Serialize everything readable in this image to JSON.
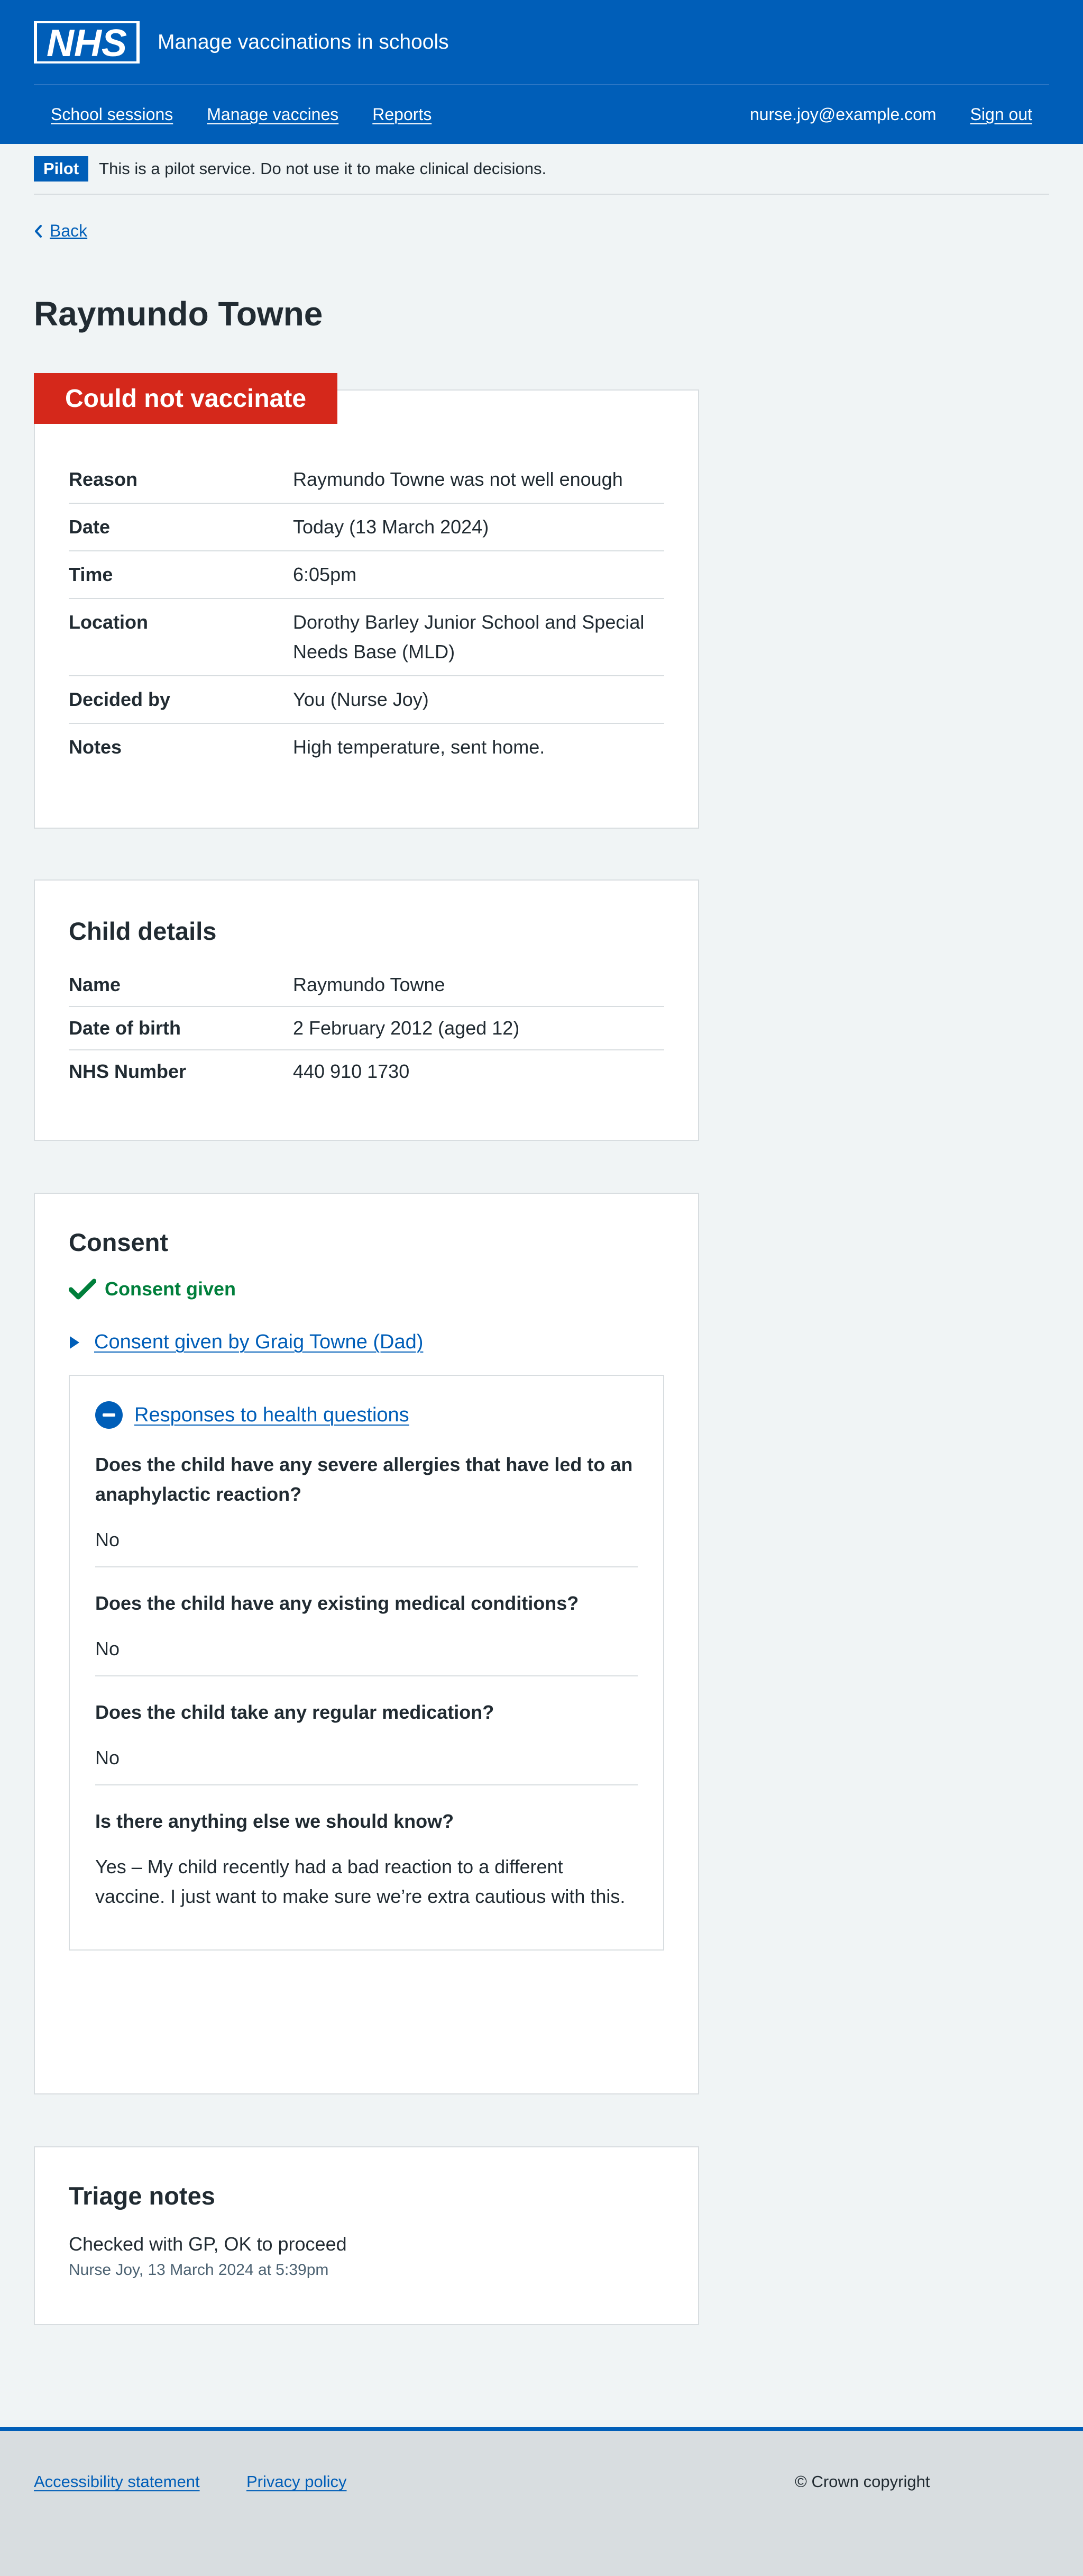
{
  "header": {
    "logo_text": "NHS",
    "service_name": "Manage vaccinations in schools",
    "nav": [
      "School sessions",
      "Manage vaccines",
      "Reports"
    ],
    "user_email": "nurse.joy@example.com",
    "sign_out": "Sign out"
  },
  "pilot": {
    "tag": "Pilot",
    "text": "This is a pilot service. Do not use it to make clinical decisions."
  },
  "back": "Back",
  "title": "Raymundo Towne",
  "outcome": {
    "status": "Could not vaccinate",
    "status_color": "#d5281b",
    "rows": [
      {
        "key": "Reason",
        "value": "Raymundo Towne was not well enough"
      },
      {
        "key": "Date",
        "value": "Today (13 March 2024)"
      },
      {
        "key": "Time",
        "value": "6:05pm"
      },
      {
        "key": "Location",
        "value": "Dorothy Barley Junior School and Special Needs Base (MLD)"
      },
      {
        "key": "Decided by",
        "value": "You (Nurse Joy)"
      },
      {
        "key": "Notes",
        "value": "High temperature, sent home."
      }
    ]
  },
  "child": {
    "heading": "Child details",
    "rows": [
      {
        "key": "Name",
        "value": "Raymundo Towne"
      },
      {
        "key": "Date of birth",
        "value": "2 February 2012 (aged 12)"
      },
      {
        "key": "NHS Number",
        "value": "440 910 1730"
      }
    ]
  },
  "consent": {
    "heading": "Consent",
    "status": "Consent given",
    "status_icon": "tick-icon",
    "summary_link": "Consent given by Graig Towne (Dad)",
    "health_link": "Responses to health questions",
    "questions": [
      {
        "q": "Does the child have any severe allergies that have led to an anaphylactic reaction?",
        "a": "No"
      },
      {
        "q": "Does the child have any existing medical conditions?",
        "a": "No"
      },
      {
        "q": "Does the child take any regular medication?",
        "a": "No"
      },
      {
        "q": "Is there anything else we should know?",
        "a": "Yes – My child recently had a bad reaction to a different vaccine. I just want to make sure we’re extra cautious with this."
      }
    ]
  },
  "triage": {
    "heading": "Triage notes",
    "text": "Checked with GP, OK to proceed",
    "meta": "Nurse Joy, 13 March 2024 at 5:39pm"
  },
  "footer": {
    "links": [
      "Accessibility statement",
      "Privacy policy"
    ],
    "copyright": "© Crown copyright"
  }
}
